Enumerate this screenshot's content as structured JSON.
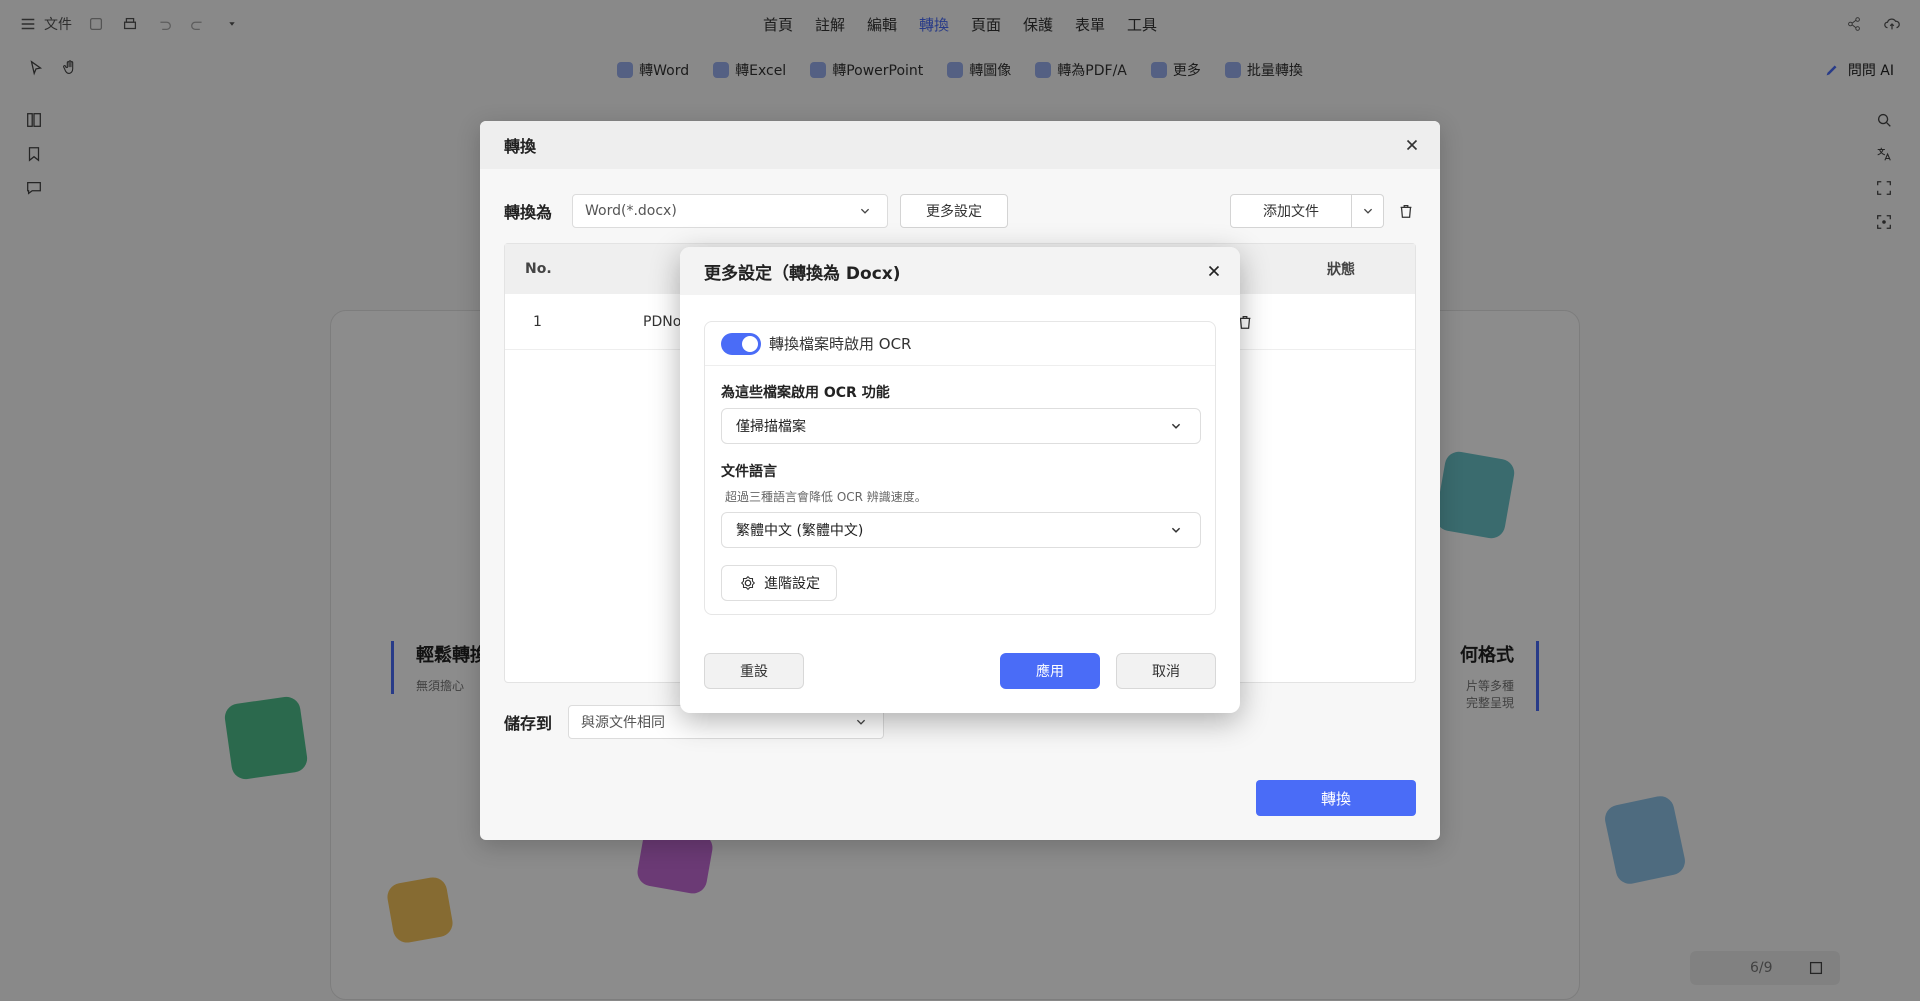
{
  "topbar": {
    "file_label": "文件",
    "nav": [
      "首頁",
      "註解",
      "編輯",
      "轉換",
      "頁面",
      "保護",
      "表單",
      "工具"
    ],
    "active_nav": "轉換"
  },
  "subbar": {
    "tabs": [
      "轉Word",
      "轉Excel",
      "轉PowerPoint",
      "轉圖像",
      "轉為PDF/A",
      "更多",
      "批量轉換"
    ],
    "ask_ai": "問問 AI"
  },
  "page_indicator": "6/9",
  "background": {
    "left_heading": "輕鬆轉換",
    "left_sub": "無須擔心",
    "right_heading": "何格式",
    "right_sub1": "片等多種",
    "right_sub2": "完整呈現"
  },
  "convert_dialog": {
    "title": "轉換",
    "convert_to_label": "轉換為",
    "format_value": "Word(*.docx)",
    "more_settings_btn": "更多設定",
    "add_file_btn": "添加文件",
    "columns": {
      "no": "No.",
      "status": "狀態"
    },
    "rows": [
      {
        "no": "1",
        "name": "PDNo"
      }
    ],
    "save_to_label": "儲存到",
    "save_to_value": "與源文件相同",
    "convert_btn": "轉換"
  },
  "more_settings": {
    "title": "更多設定（轉換為 Docx)",
    "ocr_toggle_label": "轉換檔案時啟用 OCR",
    "ocr_toggle_on": true,
    "ocr_scope_label": "為這些檔案啟用 OCR 功能",
    "ocr_scope_value": "僅掃描檔案",
    "language_label": "文件語言",
    "language_help": "超過三種語言會降低 OCR 辨識速度。",
    "language_value": "繁體中文 (繁體中文)",
    "advanced_btn": "進階設定",
    "reset_btn": "重設",
    "apply_btn": "應用",
    "cancel_btn": "取消"
  },
  "colors": {
    "accent": "#4a6cf7",
    "overlay": "rgba(0,0,0,0.45)"
  }
}
